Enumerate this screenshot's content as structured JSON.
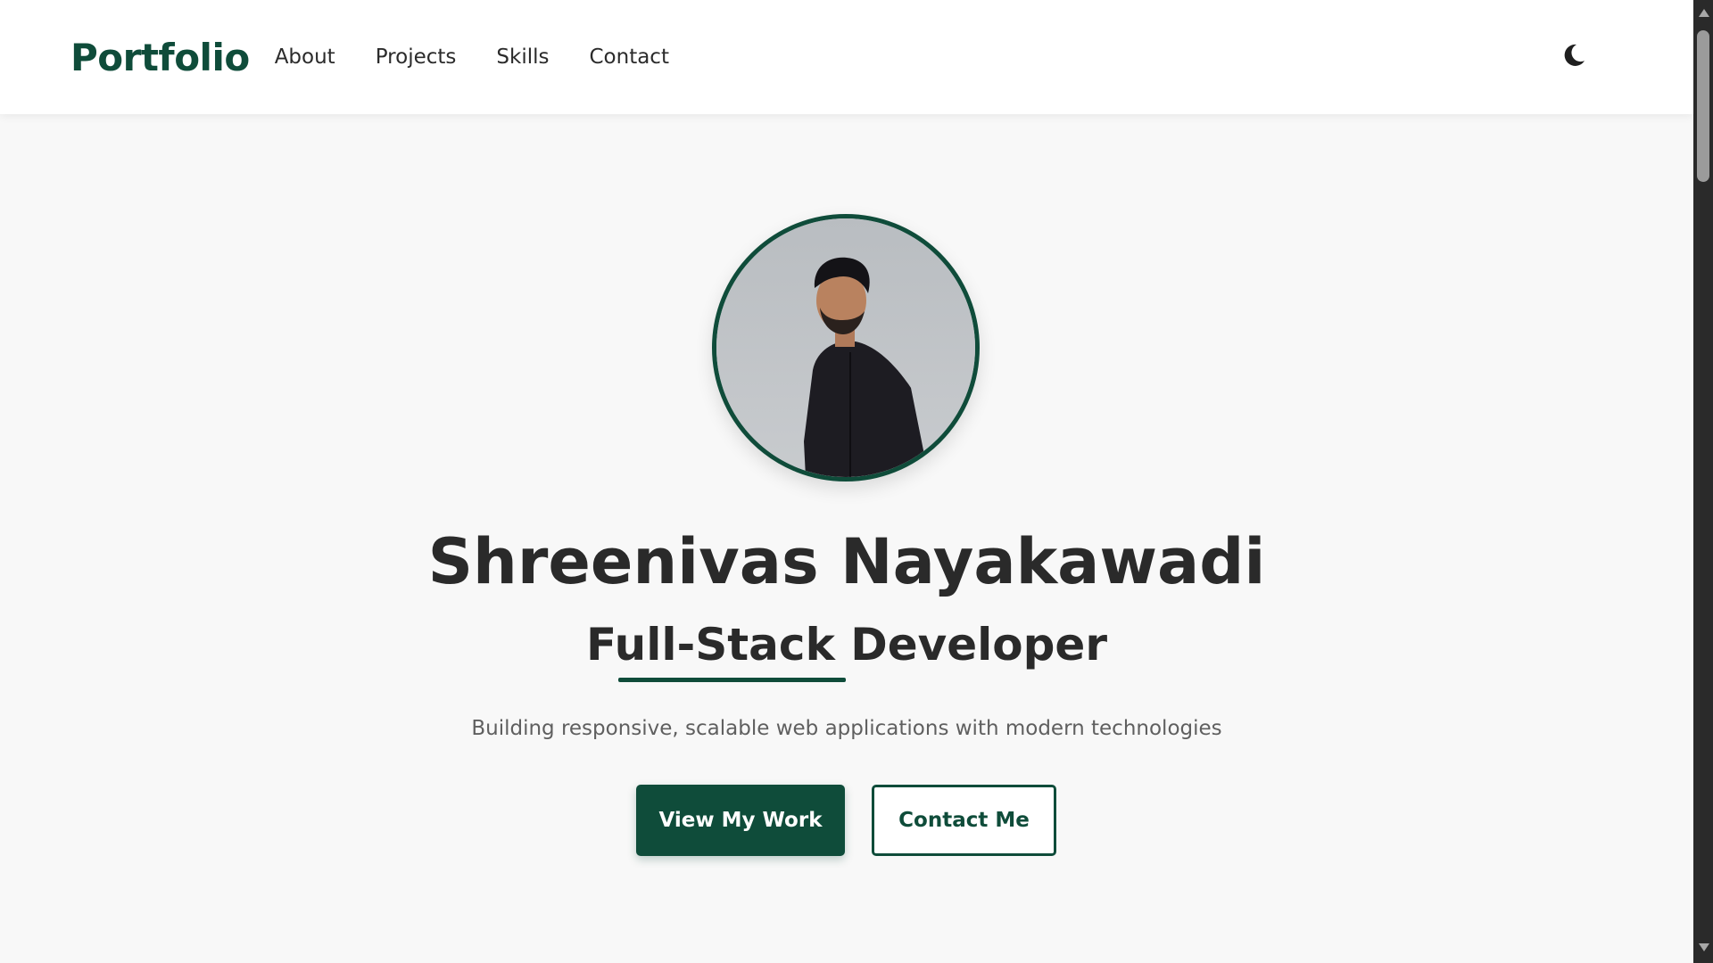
{
  "navbar": {
    "brand": "Portfolio",
    "links": [
      "About",
      "Projects",
      "Skills",
      "Contact"
    ],
    "theme_toggle_icon": "moon-icon"
  },
  "hero": {
    "avatar_icon": "profile-photo",
    "name": "Shreenivas Nayakawadi",
    "role": "Full-Stack Developer",
    "tagline": "Building responsive, scalable web applications with modern technologies",
    "primary_button": "View My Work",
    "secondary_button": "Contact Me"
  },
  "colors": {
    "accent": "#0f4c3a",
    "background": "#f8f8f8",
    "heading": "#2a2a2a",
    "muted_text": "#5f5f5f",
    "navbar_bg": "#ffffff"
  }
}
